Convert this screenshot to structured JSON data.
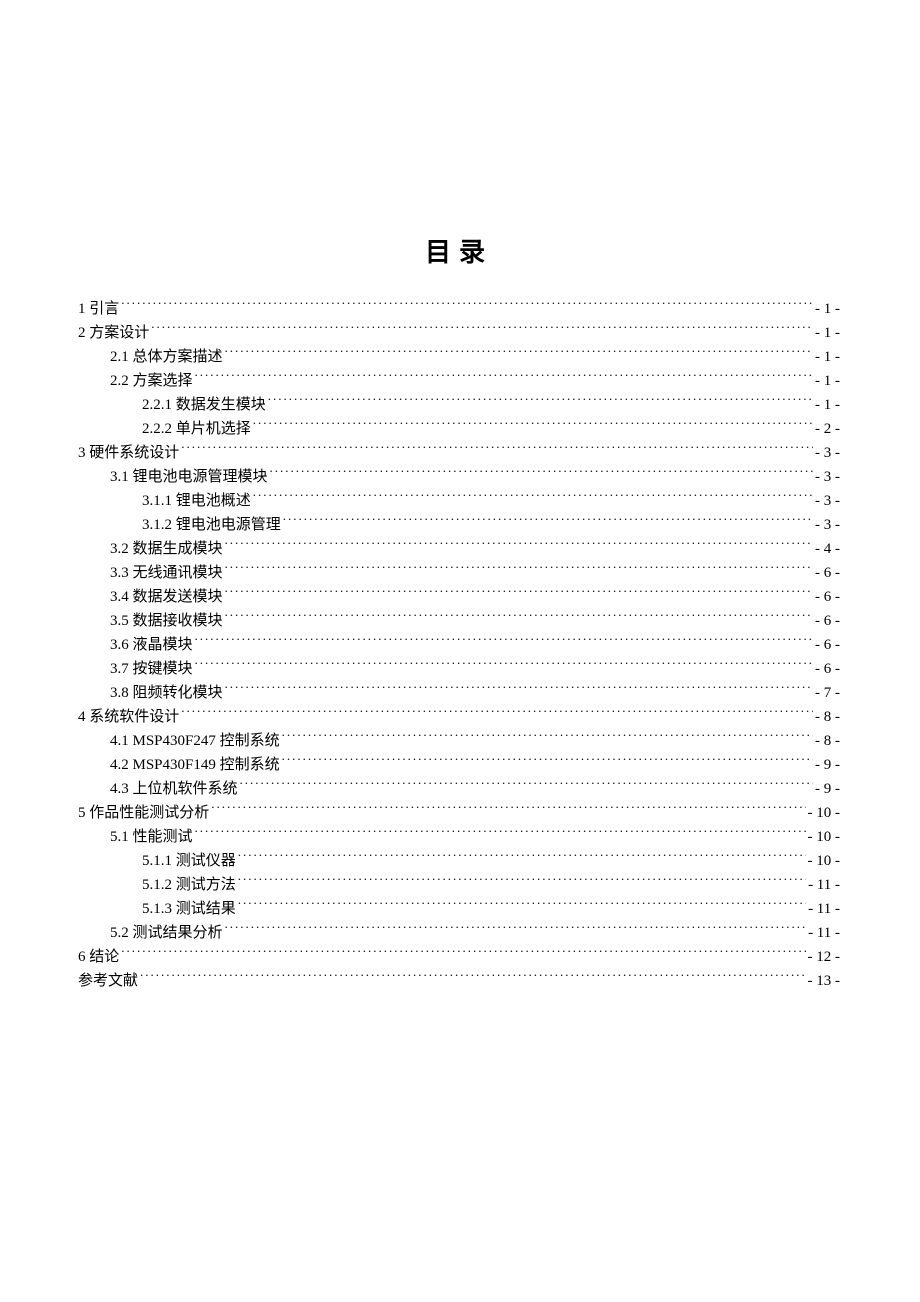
{
  "title": "目录",
  "entries": [
    {
      "level": 1,
      "text": "1 引言",
      "page": "- 1 -"
    },
    {
      "level": 1,
      "text": "2 方案设计",
      "page": "- 1 -"
    },
    {
      "level": 2,
      "text": "2.1 总体方案描述",
      "page": "- 1 -"
    },
    {
      "level": 2,
      "text": "2.2 方案选择",
      "page": "- 1 -"
    },
    {
      "level": 3,
      "text": "2.2.1 数据发生模块",
      "page": "- 1 -"
    },
    {
      "level": 3,
      "text": "2.2.2 单片机选择",
      "page": "- 2 -"
    },
    {
      "level": 1,
      "text": "3 硬件系统设计",
      "page": "- 3 -"
    },
    {
      "level": 2,
      "text": "3.1  锂电池电源管理模块",
      "page": "- 3 -"
    },
    {
      "level": 3,
      "text": "3.1.1 锂电池概述",
      "page": "- 3 -"
    },
    {
      "level": 3,
      "text": "3.1.2 锂电池电源管理",
      "page": "- 3 -"
    },
    {
      "level": 2,
      "text": "3.2 数据生成模块",
      "page": "- 4 -"
    },
    {
      "level": 2,
      "text": "3.3 无线通讯模块",
      "page": "- 6 -"
    },
    {
      "level": 2,
      "text": "3.4 数据发送模块",
      "page": "- 6 -"
    },
    {
      "level": 2,
      "text": "3.5 数据接收模块",
      "page": "- 6 -"
    },
    {
      "level": 2,
      "text": "3.6 液晶模块",
      "page": "- 6 -"
    },
    {
      "level": 2,
      "text": "3.7 按键模块",
      "page": "- 6 -"
    },
    {
      "level": 2,
      "text": "3.8 阻频转化模块",
      "page": "- 7 -"
    },
    {
      "level": 1,
      "text": "4 系统软件设计",
      "page": "- 8 -"
    },
    {
      "level": 2,
      "text": "4.1    MSP430F247 控制系统",
      "page": "- 8 -"
    },
    {
      "level": 2,
      "text": "4.2    MSP430F149 控制系统",
      "page": "- 9 -"
    },
    {
      "level": 2,
      "text": "4.3  上位机软件系统",
      "page": "- 9 -"
    },
    {
      "level": 1,
      "text": "5 作品性能测试分析",
      "page": "- 10 -"
    },
    {
      "level": 2,
      "text": "5.1 性能测试",
      "page": "- 10 -"
    },
    {
      "level": 3,
      "text": "5.1.1 测试仪器",
      "page": "- 10 -"
    },
    {
      "level": 3,
      "text": "5.1.2 测试方法",
      "page": "- 11 -"
    },
    {
      "level": 3,
      "text": "5.1.3 测试结果",
      "page": "- 11 -"
    },
    {
      "level": 2,
      "text": "5.2 测试结果分析",
      "page": "- 11 -"
    },
    {
      "level": 1,
      "text": "6 结论",
      "page": "- 12 -"
    },
    {
      "level": 1,
      "text": "参考文献",
      "page": "- 13 -"
    }
  ]
}
